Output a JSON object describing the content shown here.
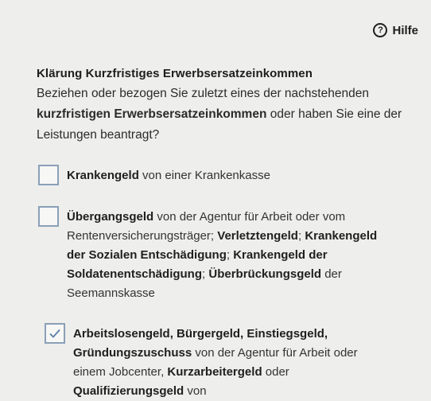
{
  "help": {
    "label": "Hilfe",
    "icon": "question-circle-icon"
  },
  "section": {
    "heading": "Klärung Kurzfristiges Erwerbsersatzeinkommen",
    "question": {
      "part1": "Beziehen oder bezogen Sie zuletzt eines der nachstehenden ",
      "bold": "kurzfristigen Erwerbsersatzeinkommen",
      "part2": " oder haben Sie eine der Leistungen beantragt?"
    }
  },
  "options": [
    {
      "checked": false,
      "segments": [
        {
          "b": "Krankengeld"
        },
        {
          "t": " von einer Krankenkasse"
        }
      ]
    },
    {
      "checked": false,
      "segments": [
        {
          "b": "Übergangsgeld"
        },
        {
          "t": " von der Agentur für Arbeit oder vom Rentenversicherungsträger; "
        },
        {
          "b": "Verletztengeld"
        },
        {
          "t": "; "
        },
        {
          "b": "Krankengeld der Sozialen Entschädigung"
        },
        {
          "t": "; "
        },
        {
          "b": "Krankengeld der Soldatenentschädigung"
        },
        {
          "t": "; "
        },
        {
          "b": "Überbrückungsgeld"
        },
        {
          "t": " der Seemannskasse"
        }
      ]
    },
    {
      "checked": true,
      "segments": [
        {
          "b": "Arbeitslosengeld, Bürgergeld, Einstiegsgeld, Gründungszuschuss"
        },
        {
          "t": " von der Agentur für Arbeit oder einem Jobcenter, "
        },
        {
          "b": "Kurzarbeitergeld"
        },
        {
          "t": " oder "
        },
        {
          "b": "Qualifizierungsgeld"
        },
        {
          "t": " von"
        }
      ]
    }
  ],
  "colors": {
    "background": "#eeeeec",
    "checkbox_border": "#8aa0b8",
    "check": "#5a7fa6"
  }
}
